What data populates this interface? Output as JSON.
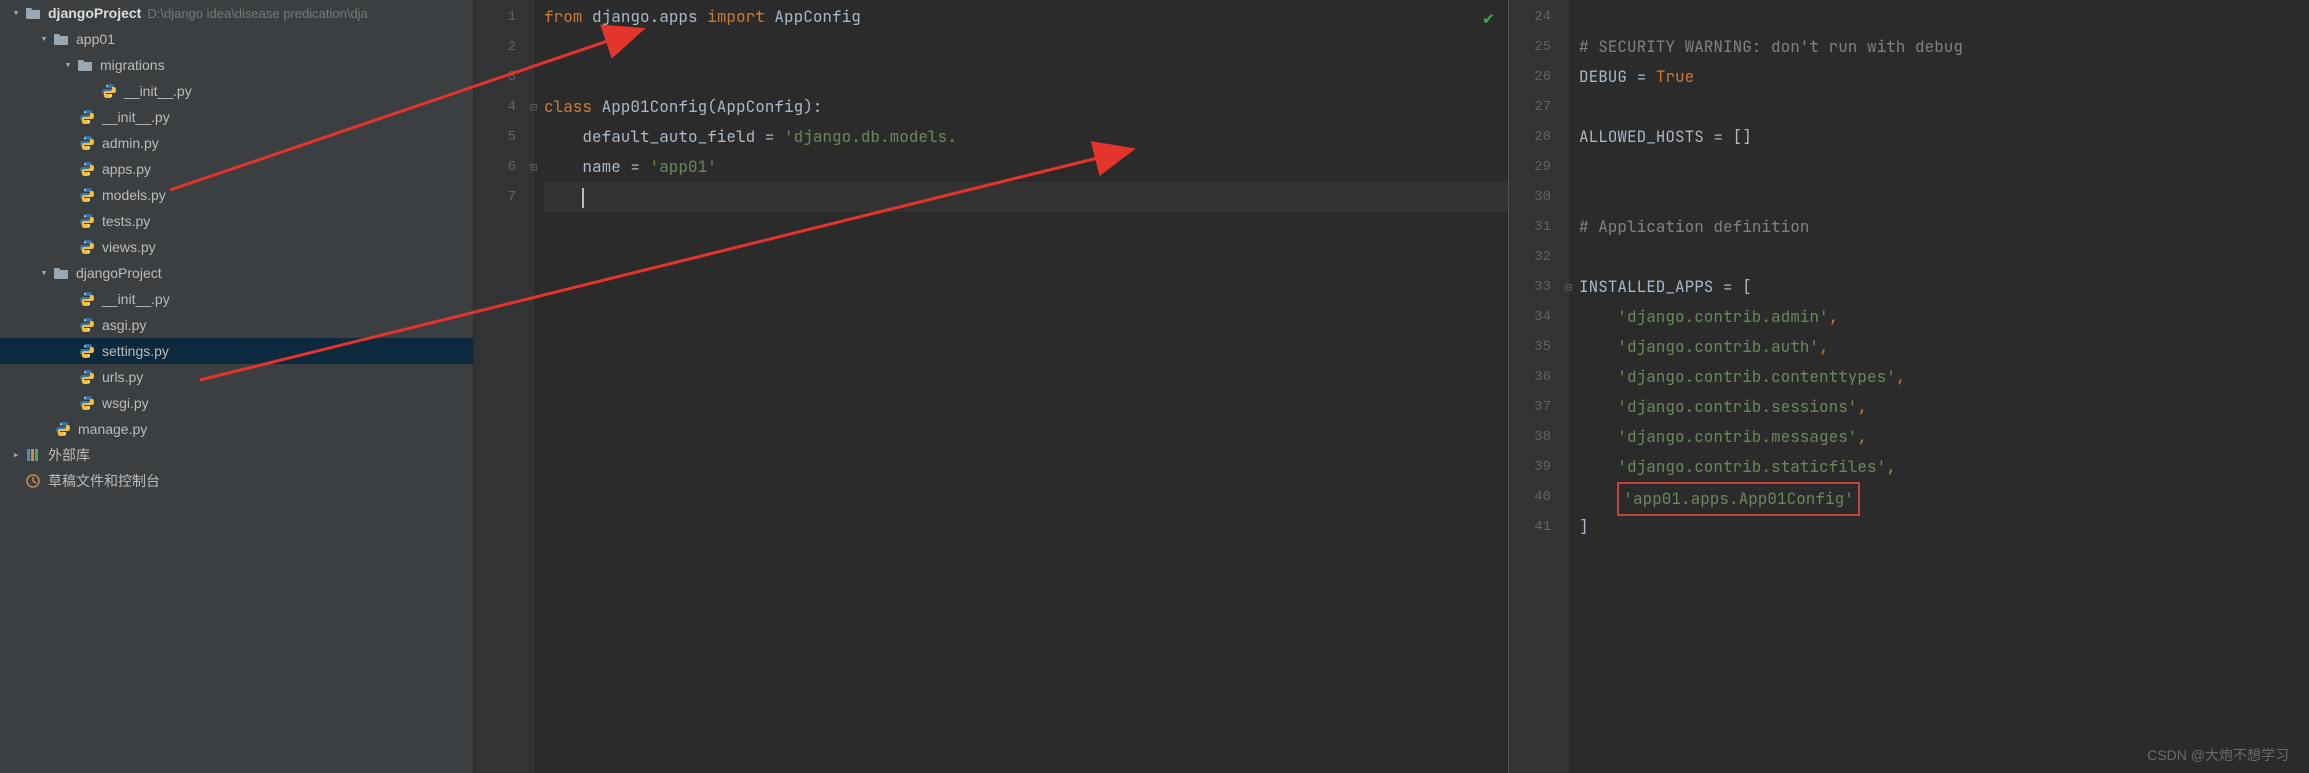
{
  "tree": {
    "root": {
      "label": "djangoProject",
      "path": "D:\\django idea\\disease predication\\dja"
    },
    "app01": "app01",
    "migrations": "migrations",
    "mig_init": "__init__.py",
    "app_init": "__init__.py",
    "admin": "admin.py",
    "apps": "apps.py",
    "models": "models.py",
    "tests": "tests.py",
    "views": "views.py",
    "proj": "djangoProject",
    "proj_init": "__init__.py",
    "asgi": "asgi.py",
    "settings": "settings.py",
    "urls": "urls.py",
    "wsgi": "wsgi.py",
    "manage": "manage.py",
    "ext_lib": "外部库",
    "scratch": "草稿文件和控制台"
  },
  "editor1": {
    "lines": [
      "1",
      "2",
      "3",
      "4",
      "5",
      "6",
      "7"
    ],
    "l1": {
      "a": "from ",
      "b": "django.apps ",
      "c": "import ",
      "d": "AppConfig"
    },
    "l4": {
      "a": "class ",
      "b": "App01Config(AppConfig):"
    },
    "l5": {
      "a": "    default_auto_field = ",
      "b": "'django.db.models."
    },
    "l6": {
      "a": "    name = ",
      "b": "'app01'"
    }
  },
  "editor2": {
    "lines": [
      "24",
      "25",
      "26",
      "27",
      "28",
      "29",
      "30",
      "31",
      "32",
      "33",
      "34",
      "35",
      "36",
      "37",
      "38",
      "39",
      "40",
      "41"
    ],
    "c25": "# SECURITY WARNING: don't run with debug",
    "l26": {
      "a": "DEBUG = ",
      "b": "True"
    },
    "l28": "ALLOWED_HOSTS = []",
    "c31": "# Application definition",
    "l33": "INSTALLED_APPS = [",
    "s34": "'django.contrib.admin'",
    "s35": "'django.contrib.auth'",
    "s36": "'django.contrib.contenttypes'",
    "s37": "'django.contrib.sessions'",
    "s38": "'django.contrib.messages'",
    "s39": "'django.contrib.staticfiles'",
    "s40": "'app01.apps.App01Config'",
    "comma": ",",
    "l41": "]"
  },
  "watermark": "CSDN @大炮不想学习"
}
